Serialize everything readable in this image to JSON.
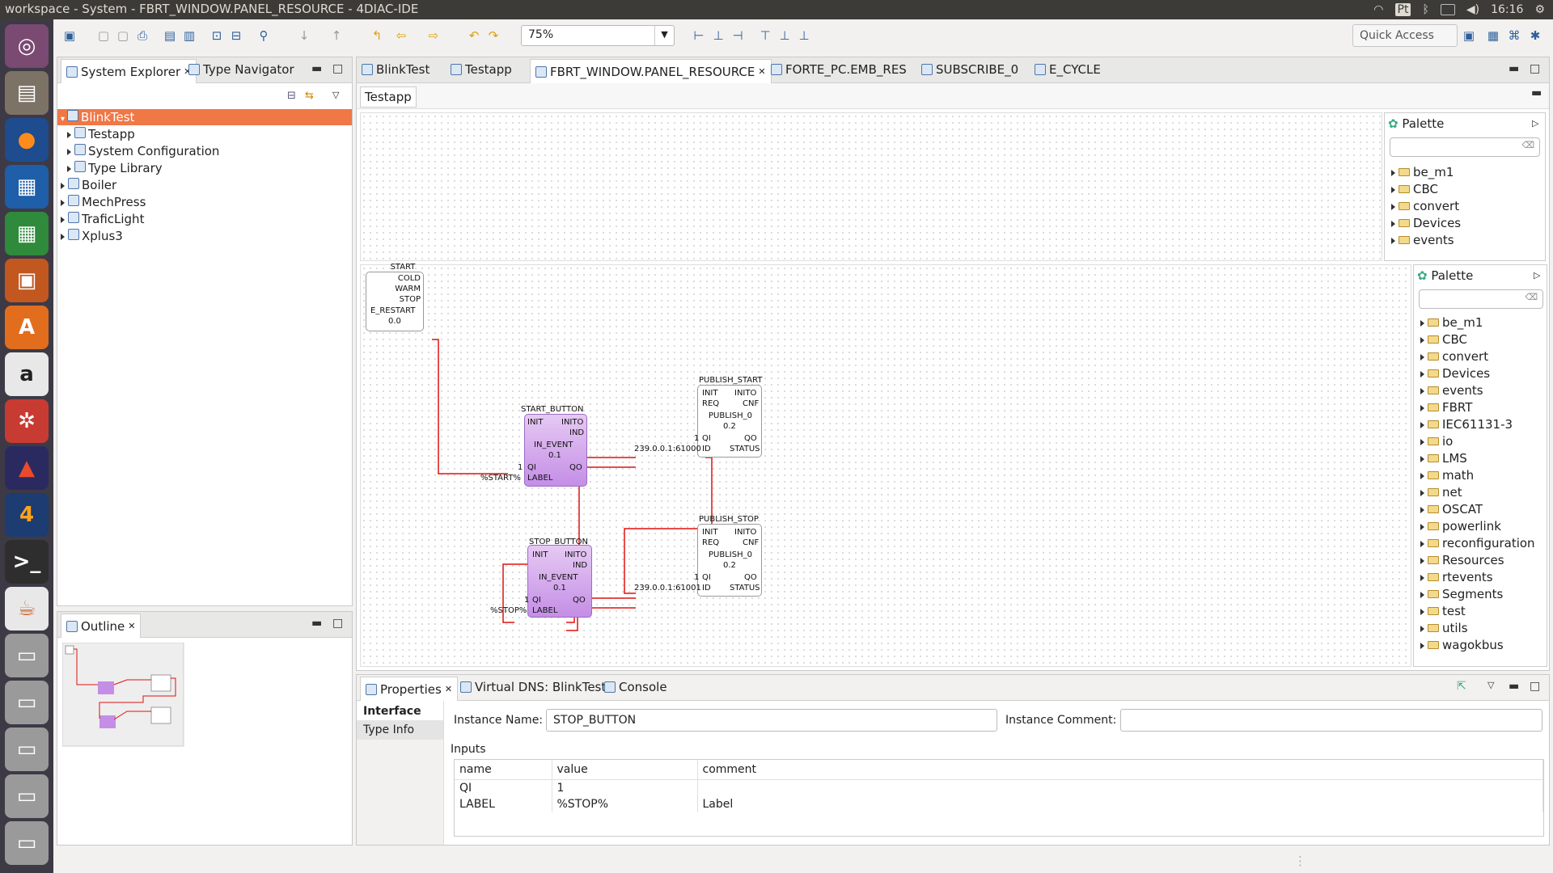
{
  "window": {
    "title": "workspace - System - FBRT_WINDOW.PANEL_RESOURCE - 4DIAC-IDE",
    "clock": "16:16",
    "input_method": "Pt"
  },
  "toolbar": {
    "zoom_value": "75%",
    "quick_access": "Quick Access"
  },
  "system_explorer": {
    "tab_label": "System Explorer",
    "tab2_label": "Type Navigator",
    "items": [
      {
        "label": "BlinkTest"
      },
      {
        "label": "Testapp"
      },
      {
        "label": "System Configuration"
      },
      {
        "label": "Type Library"
      },
      {
        "label": "Boiler"
      },
      {
        "label": "MechPress"
      },
      {
        "label": "TraficLight"
      },
      {
        "label": "Xplus3"
      }
    ]
  },
  "outline": {
    "tab_label": "Outline"
  },
  "editor_tabs": [
    {
      "label": "BlinkTest"
    },
    {
      "label": "Testapp"
    },
    {
      "label": "FBRT_WINDOW.PANEL_RESOURCE"
    },
    {
      "label": "FORTE_PC.EMB_RES"
    },
    {
      "label": "SUBSCRIBE_0"
    },
    {
      "label": "E_CYCLE"
    }
  ],
  "subeditor_tab": "Testapp",
  "palette1": {
    "title": "Palette",
    "items": [
      "be_m1",
      "CBC",
      "convert",
      "Devices",
      "events"
    ]
  },
  "palette2": {
    "title": "Palette",
    "items": [
      "be_m1",
      "CBC",
      "convert",
      "Devices",
      "events",
      "FBRT",
      "IEC61131-3",
      "io",
      "LMS",
      "math",
      "net",
      "OSCAT",
      "powerlink",
      "reconfiguration",
      "Resources",
      "rtevents",
      "Segments",
      "test",
      "utils",
      "wagokbus"
    ]
  },
  "diagram": {
    "start_block": {
      "name": "START",
      "pins": [
        "COLD",
        "WARM",
        "STOP"
      ],
      "type": "E_RESTART",
      "version": "0.0"
    },
    "start_button": {
      "name": "START_BUTTON",
      "in_events": [
        "INIT"
      ],
      "out_events": [
        "INITO",
        "IND"
      ],
      "type": "IN_EVENT",
      "version": "0.1",
      "in_data": [
        "QI",
        "LABEL"
      ],
      "out_data": [
        "QO"
      ],
      "qi_value": "1",
      "label_value": "%START%"
    },
    "stop_button": {
      "name": "STOP_BUTTON",
      "in_events": [
        "INIT"
      ],
      "out_events": [
        "INITO",
        "IND"
      ],
      "type": "IN_EVENT",
      "version": "0.1",
      "in_data": [
        "QI",
        "LABEL"
      ],
      "out_data": [
        "QO"
      ],
      "qi_value": "1",
      "label_value": "%STOP%"
    },
    "publish_start": {
      "name": "PUBLISH_START",
      "in_events": [
        "INIT",
        "REQ"
      ],
      "out_events": [
        "INITO",
        "CNF"
      ],
      "type": "PUBLISH_0",
      "version": "0.2",
      "in_data": [
        "QI",
        "ID"
      ],
      "out_data": [
        "QO",
        "STATUS"
      ],
      "qi_value": "1",
      "id_value": "239.0.0.1:61000"
    },
    "publish_stop": {
      "name": "PUBLISH_STOP",
      "in_events": [
        "INIT",
        "REQ"
      ],
      "out_events": [
        "INITO",
        "CNF"
      ],
      "type": "PUBLISH_0",
      "version": "0.2",
      "in_data": [
        "QI",
        "ID"
      ],
      "out_data": [
        "QO",
        "STATUS"
      ],
      "qi_value": "1",
      "id_value": "239.0.0.1:61001"
    }
  },
  "bottom_tabs": [
    {
      "label": "Properties"
    },
    {
      "label": "Virtual DNS: BlinkTest"
    },
    {
      "label": "Console"
    }
  ],
  "properties": {
    "side_tabs": [
      "Interface",
      "Type Info"
    ],
    "instance_name_label": "Instance Name:",
    "instance_name_value": "STOP_BUTTON",
    "instance_comment_label": "Instance Comment:",
    "instance_comment_value": "",
    "inputs_title": "Inputs",
    "columns": [
      "name",
      "value",
      "comment"
    ],
    "rows": [
      {
        "name": "QI",
        "value": "1",
        "comment": ""
      },
      {
        "name": "LABEL",
        "value": "%STOP%",
        "comment": "Label"
      }
    ]
  },
  "colors": {
    "selection": "#f07746",
    "connection": "#e01010",
    "fb_purple": "#c48ee6",
    "launcher": "#3d3a45"
  }
}
